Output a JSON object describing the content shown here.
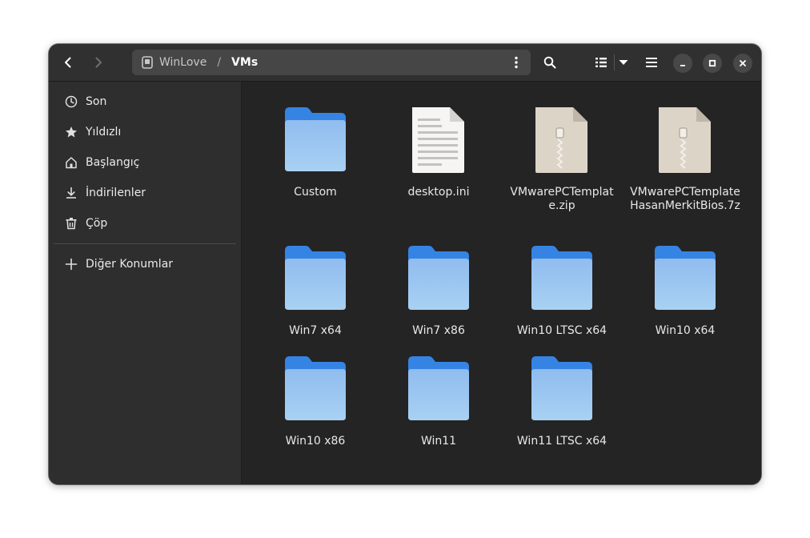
{
  "headerbar": {
    "back_icon": "go-back-icon",
    "forward_icon": "go-forward-icon",
    "path": {
      "root": "WinLove",
      "separator": "/",
      "current": "VMs"
    },
    "search_icon": "search-icon",
    "view_icon": "list-view-icon",
    "menu_icon": "hamburger-menu-icon"
  },
  "sidebar": {
    "items": [
      {
        "label": "Son",
        "icon": "clock-icon"
      },
      {
        "label": "Yıldızlı",
        "icon": "star-icon"
      },
      {
        "label": "Başlangıç",
        "icon": "home-icon"
      },
      {
        "label": "İndirilenler",
        "icon": "download-icon"
      },
      {
        "label": "Çöp",
        "icon": "trash-icon"
      }
    ],
    "other": {
      "label": "Diğer Konumlar",
      "icon": "plus-icon"
    }
  },
  "files": [
    {
      "name": "Custom",
      "type": "folder"
    },
    {
      "name": "desktop.ini",
      "type": "text"
    },
    {
      "name": "VMwarePCTemplate.zip",
      "type": "archive"
    },
    {
      "name": "VMwarePCTemplateHasanMerkitBios.7z",
      "type": "archive"
    },
    {
      "name": "Win7 x64",
      "type": "folder"
    },
    {
      "name": "Win7 x86",
      "type": "folder"
    },
    {
      "name": "Win10 LTSC x64",
      "type": "folder"
    },
    {
      "name": "Win10 x64",
      "type": "folder"
    },
    {
      "name": "Win10 x86",
      "type": "folder"
    },
    {
      "name": "Win11",
      "type": "folder"
    },
    {
      "name": "Win11 LTSC x64",
      "type": "folder"
    }
  ],
  "colors": {
    "folder_back": "#3584e4",
    "folder_front_top": "#99c1f1",
    "folder_front_bottom": "#a9cdf2",
    "archive": "#d9cfc2"
  }
}
